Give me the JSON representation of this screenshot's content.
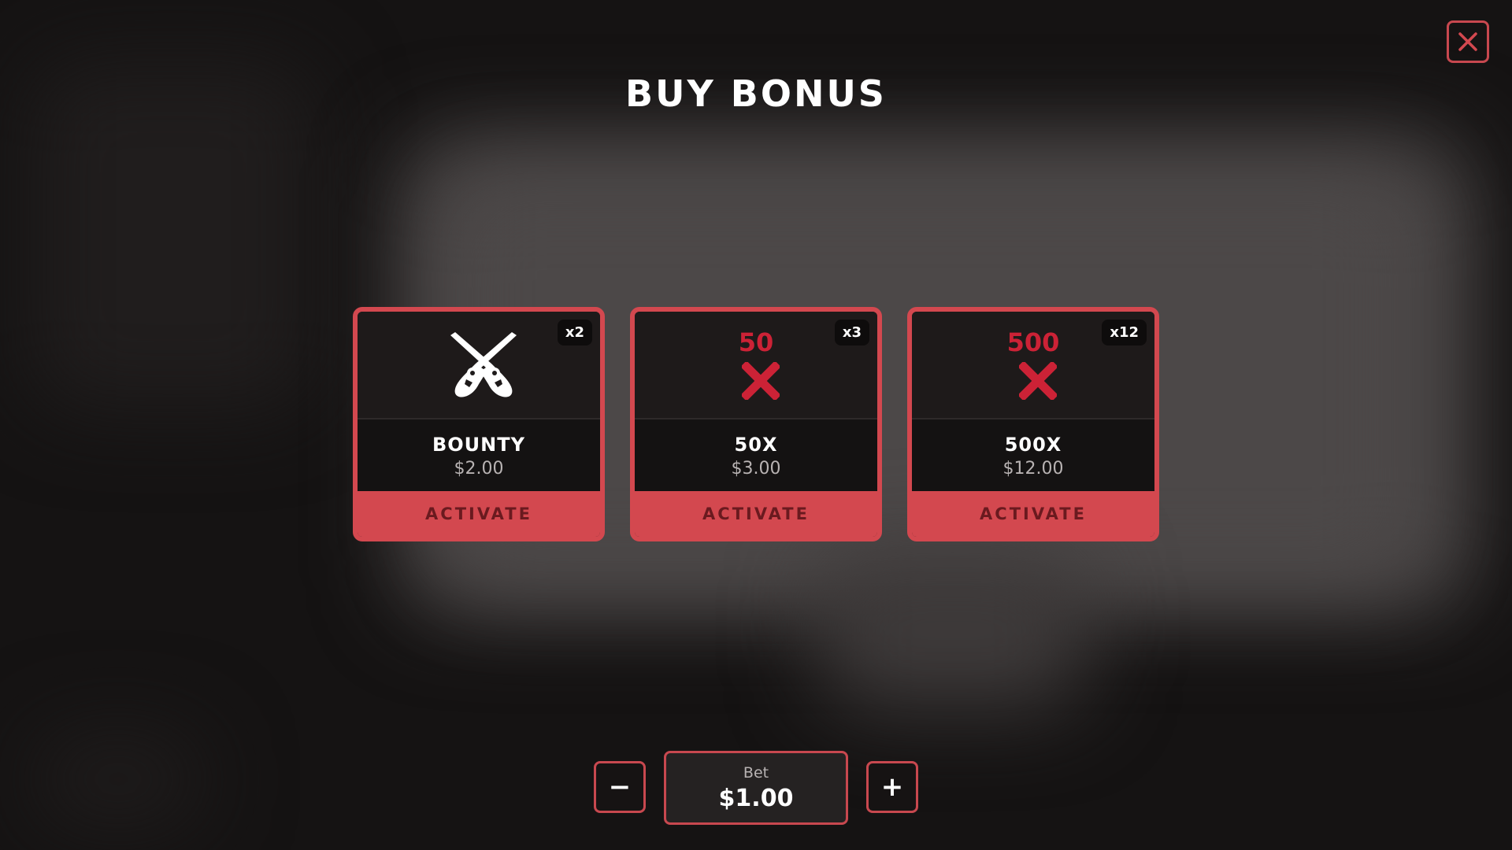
{
  "title": "BUY BONUS",
  "close_icon": "close-icon",
  "colors": {
    "accent": "#d3484f",
    "multiplier_red": "#cc2236",
    "background": "#151313"
  },
  "cards": [
    {
      "name": "BOUNTY",
      "price": "$2.00",
      "badge": "x2",
      "icon": "crossed-revolvers-icon",
      "multiplier": "",
      "button_label": "ACTIVATE"
    },
    {
      "name": "50X",
      "price": "$3.00",
      "badge": "x3",
      "icon": "multiplier-x-icon",
      "multiplier": "50",
      "button_label": "ACTIVATE"
    },
    {
      "name": "500X",
      "price": "$12.00",
      "badge": "x12",
      "icon": "multiplier-x-icon",
      "multiplier": "500",
      "button_label": "ACTIVATE"
    }
  ],
  "bet": {
    "label": "Bet",
    "value": "$1.00",
    "decrease_label": "−",
    "increase_label": "+"
  }
}
